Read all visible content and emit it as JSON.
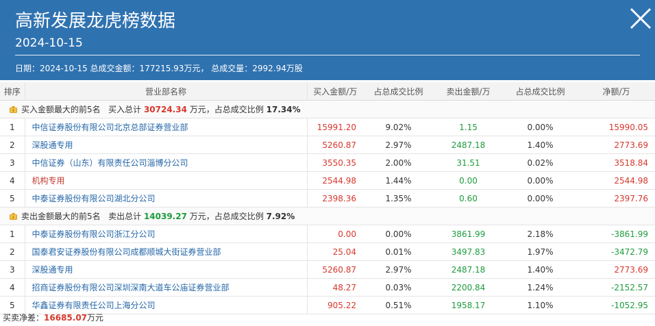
{
  "header": {
    "title": "高新发展龙虎榜数据",
    "date": "2024-10-15",
    "summary": "日期：2024-10-15 总成交金额：177215.93万元， 总成交量：2992.94万股"
  },
  "columns": [
    "排序",
    "营业部名称",
    "买入金额/万",
    "占总成交比例",
    "卖出金额/万",
    "占总成交比例",
    "净额/万"
  ],
  "buy_section": {
    "label": "买入金额最大的前5名",
    "total_prefix": "买入总计",
    "total": "30724.34",
    "total_suffix": "万元，占总成交比例",
    "ratio": "17.34%",
    "rows": [
      {
        "rank": "1",
        "name": "中信证券股份有限公司北京总部证券营业部",
        "buy": "15991.20",
        "buy_pct": "9.02%",
        "sell": "1.15",
        "sell_pct": "0.00%",
        "net": "15990.05",
        "net_sign": "pos",
        "inst": false
      },
      {
        "rank": "2",
        "name": "深股通专用",
        "buy": "5260.87",
        "buy_pct": "2.97%",
        "sell": "2487.18",
        "sell_pct": "1.40%",
        "net": "2773.69",
        "net_sign": "pos",
        "inst": false
      },
      {
        "rank": "3",
        "name": "中信证券（山东）有限责任公司淄博分公司",
        "buy": "3550.35",
        "buy_pct": "2.00%",
        "sell": "31.51",
        "sell_pct": "0.02%",
        "net": "3518.84",
        "net_sign": "pos",
        "inst": false
      },
      {
        "rank": "4",
        "name": "机构专用",
        "buy": "2544.98",
        "buy_pct": "1.44%",
        "sell": "0.00",
        "sell_pct": "0.00%",
        "net": "2544.98",
        "net_sign": "pos",
        "inst": true
      },
      {
        "rank": "5",
        "name": "中泰证券股份有限公司湖北分公司",
        "buy": "2398.36",
        "buy_pct": "1.35%",
        "sell": "0.60",
        "sell_pct": "0.00%",
        "net": "2397.76",
        "net_sign": "pos",
        "inst": false
      }
    ]
  },
  "sell_section": {
    "label": "卖出金额最大的前5名",
    "total_prefix": "卖出总计",
    "total": "14039.27",
    "total_suffix": "万元，占总成交比例",
    "ratio": "7.92%",
    "rows": [
      {
        "rank": "1",
        "name": "中泰证券股份有限公司浙江分公司",
        "buy": "0.00",
        "buy_pct": "0.00%",
        "sell": "3861.99",
        "sell_pct": "2.18%",
        "net": "-3861.99",
        "net_sign": "neg",
        "inst": false
      },
      {
        "rank": "2",
        "name": "国泰君安证券股份有限公司成都顺城大街证券营业部",
        "buy": "25.04",
        "buy_pct": "0.01%",
        "sell": "3497.83",
        "sell_pct": "1.97%",
        "net": "-3472.79",
        "net_sign": "neg",
        "inst": false
      },
      {
        "rank": "3",
        "name": "深股通专用",
        "buy": "5260.87",
        "buy_pct": "2.97%",
        "sell": "2487.18",
        "sell_pct": "1.40%",
        "net": "2773.69",
        "net_sign": "pos",
        "inst": false
      },
      {
        "rank": "4",
        "name": "招商证券股份有限公司深圳深南大道车公庙证券营业部",
        "buy": "48.27",
        "buy_pct": "0.03%",
        "sell": "2200.84",
        "sell_pct": "1.24%",
        "net": "-2152.57",
        "net_sign": "neg",
        "inst": false
      },
      {
        "rank": "5",
        "name": "华鑫证券有限责任公司上海分公司",
        "buy": "905.22",
        "buy_pct": "0.51%",
        "sell": "1958.17",
        "sell_pct": "1.10%",
        "net": "-1052.95",
        "net_sign": "neg",
        "inst": false
      }
    ]
  },
  "footer": {
    "label": "买卖净差：",
    "value": "16685.07",
    "unit": "万元"
  },
  "colors": {
    "header_bg": "#2f72b0",
    "positive": "#d7372c",
    "negative": "#1d9c3c",
    "link": "#2466a8"
  },
  "icons": {
    "close": "close-icon",
    "section": "money-bag-icon"
  }
}
